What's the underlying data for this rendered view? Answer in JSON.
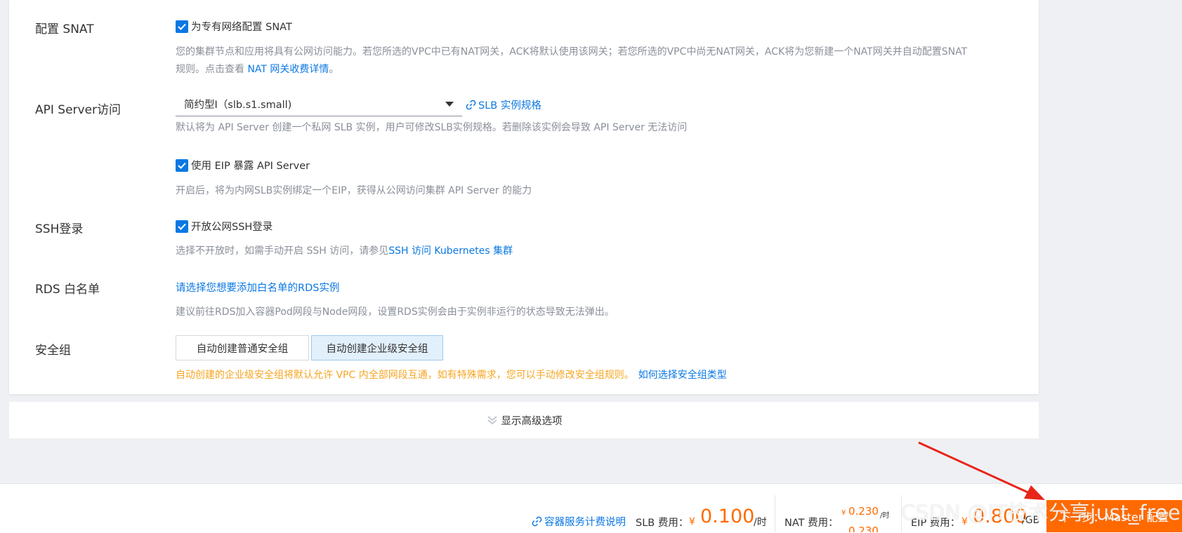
{
  "snat": {
    "label": "配置 SNAT",
    "checkbox_label": "为专有网络配置 SNAT",
    "checked": true,
    "help_line1": "您的集群节点和应用将具有公网访问能力。若您所选的VPC中已有NAT网关，ACK将默认使用该网关；若您所选的VPC中尚无NAT网关，ACK将为您新建一个NAT网关并自动配置SNAT",
    "help_line2": "规则。点击查看 ",
    "help_link": "NAT 网关收费详情",
    "help_end": "。"
  },
  "api_server": {
    "label": "API Server访问",
    "select_value": "简约型I（slb.s1.small)",
    "spec_link": "SLB 实例规格",
    "help": "默认将为 API Server 创建一个私网 SLB 实例，用户可修改SLB实例规格。若删除该实例会导致 API Server 无法访问",
    "eip_checkbox_label": "使用 EIP 暴露 API Server",
    "eip_checked": true,
    "eip_help": "开启后，将为内网SLB实例绑定一个EIP，获得从公网访问集群 API Server 的能力"
  },
  "ssh": {
    "label": "SSH登录",
    "checkbox_label": "开放公网SSH登录",
    "checked": true,
    "help_prefix": "选择不开放时，如需手动开启 SSH 访问，请参见",
    "help_link": "SSH 访问 Kubernetes 集群"
  },
  "rds": {
    "label": "RDS 白名单",
    "select_link": "请选择您想要添加白名单的RDS实例",
    "help": "建议前往RDS加入容器Pod网段与Node网段，设置RDS实例会由于实例非运行的状态导致无法弹出。"
  },
  "security_group": {
    "label": "安全组",
    "option_normal": "自动创建普通安全组",
    "option_enterprise": "自动创建企业级安全组",
    "selected": "option_enterprise",
    "warning": "自动创建的企业级安全组将默认允许 VPC 内全部网段互通，如有特殊需求，您可以手动修改安全组规则。",
    "warning_link": "如何选择安全组类型"
  },
  "advanced": {
    "toggle_label": "显示高级选项"
  },
  "footer": {
    "pricing_link": "容器服务计费说明",
    "slb_label": "SLB 费用：",
    "slb_currency": "¥",
    "slb_price": "0.100",
    "slb_unit": "/时",
    "nat_label": "NAT 费用：",
    "nat_currency": "¥",
    "nat_price": "0.230",
    "nat_unit": "/时",
    "nat_price2": "0.230",
    "eip_label": "EIP 费用：",
    "eip_currency": "¥",
    "eip_price": "0.800",
    "eip_unit": "/GB",
    "next_button": "下一步：Master 配置"
  },
  "watermark": "CSDN @IT技术分享just_free",
  "colors": {
    "primary": "#0b78e3",
    "accent_orange": "#ff6a00",
    "warning": "#f5a623",
    "annotation_arrow": "#e8251b"
  }
}
